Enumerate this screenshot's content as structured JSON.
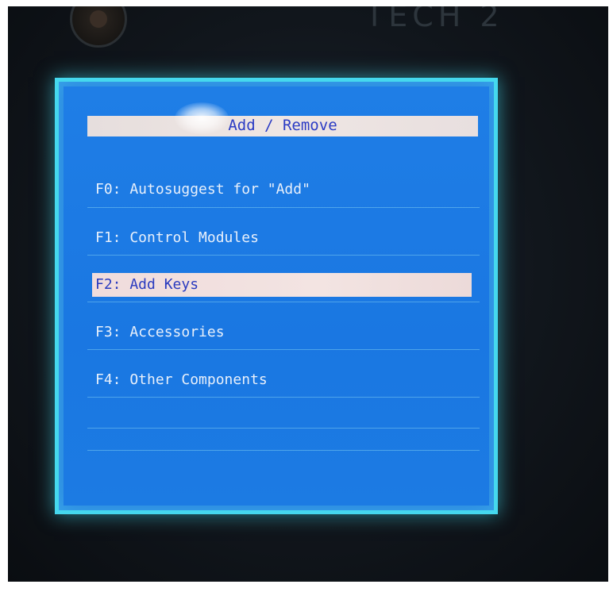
{
  "device": {
    "logo_icon": "scania-griffin-logo-icon",
    "brand_text": "TECH 2"
  },
  "screen": {
    "title": "Add / Remove",
    "menu": [
      {
        "label": "F0: Autosuggest for \"Add\"",
        "selected": false
      },
      {
        "label": "F1: Control Modules",
        "selected": false
      },
      {
        "label": "F2: Add Keys",
        "selected": true
      },
      {
        "label": "F3: Accessories",
        "selected": false
      },
      {
        "label": "F4: Other Components",
        "selected": false
      }
    ]
  },
  "colors": {
    "screen_background": "#1f7ee6",
    "screen_glow": "#45d8ee",
    "highlight_bar": "#f0e2e0",
    "highlight_text": "#2a3bbf",
    "menu_text": "#e8f0fb"
  }
}
